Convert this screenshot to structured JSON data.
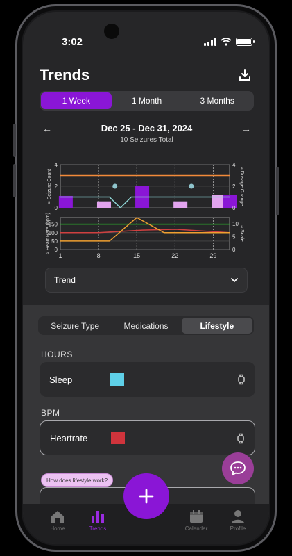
{
  "status": {
    "time": "3:02"
  },
  "header": {
    "title": "Trends"
  },
  "range_tabs": [
    {
      "label": "1 Week",
      "active": true
    },
    {
      "label": "1 Month",
      "active": false
    },
    {
      "label": "3 Months",
      "active": false
    }
  ],
  "date_nav": {
    "range": "Dec 25 - Dec 31, 2024",
    "subtitle": "10 Seizures Total"
  },
  "chart_data": [
    {
      "type": "bar",
      "y_axis_left": {
        "label": "Seizure Count",
        "ticks": [
          "0",
          "2",
          "4"
        ],
        "ylim": [
          0,
          4
        ]
      },
      "y_axis_right": {
        "label": "Dosage Change",
        "ticks": [
          "0",
          "2",
          "4"
        ],
        "ylim": [
          0,
          4
        ]
      },
      "bars": [
        {
          "x": 1,
          "value": 1.1,
          "color": "#8a16d6"
        },
        {
          "x": 8,
          "value": 0.6,
          "color": "#e2a4ef"
        },
        {
          "x": 15,
          "value": 2.0,
          "color": "#8a16d6"
        },
        {
          "x": 22,
          "value": 0.6,
          "color": "#e2a4ef"
        },
        {
          "x": 29,
          "value": 1.2,
          "color": "#e2a4ef"
        },
        {
          "x": 31,
          "value": 1.2,
          "color": "#8a16d6"
        }
      ],
      "markers": [
        {
          "x": 10,
          "value": 2.0
        },
        {
          "x": 24,
          "value": 2.0
        }
      ],
      "reference_lines": [
        {
          "value": 3.0,
          "color": "#f28a3a"
        }
      ],
      "series": [
        {
          "color": "#8fd6d6",
          "points": [
            [
              0,
              1.0
            ],
            [
              9,
              1.0
            ],
            [
              11,
              0.0
            ],
            [
              13,
              1.0
            ],
            [
              31,
              1.0
            ]
          ]
        }
      ]
    },
    {
      "type": "line",
      "x_ticks": [
        "1",
        "8",
        "15",
        "22",
        "29"
      ],
      "y_axis_left": {
        "label": "Heart Rate (bpm)",
        "ticks": [
          "0",
          "50",
          "100",
          "150"
        ],
        "ylim": [
          0,
          150
        ]
      },
      "y_axis_right": {
        "label": "Scale",
        "ticks": [
          "0",
          "5",
          "10"
        ],
        "ylim": [
          0,
          10
        ]
      },
      "series": [
        {
          "color": "#2fbf2f",
          "axis": "left",
          "points": [
            [
              0,
              150
            ],
            [
              31,
              150
            ]
          ]
        },
        {
          "color": "#d04040",
          "axis": "left",
          "points": [
            [
              0,
              100
            ],
            [
              7,
              100
            ],
            [
              15,
              115
            ],
            [
              21,
              120
            ],
            [
              31,
              100
            ]
          ]
        },
        {
          "color": "#f0a030",
          "axis": "left",
          "points": [
            [
              0,
              50
            ],
            [
              9,
              50
            ],
            [
              14,
              190
            ],
            [
              19,
              100
            ],
            [
              31,
              100
            ]
          ]
        }
      ]
    }
  ],
  "trend_select": {
    "value": "Trend"
  },
  "detail_tabs": [
    {
      "label": "Seizure Type",
      "active": false
    },
    {
      "label": "Medications",
      "active": false
    },
    {
      "label": "Lifestyle",
      "active": true
    }
  ],
  "sections": [
    {
      "heading": "HOURS",
      "metric": "Sleep",
      "color": "#5fd0e8"
    },
    {
      "heading": "BPM",
      "metric": "Heartrate",
      "color": "#d0343c"
    }
  ],
  "help_pill": "How does lifestyle work?",
  "tabbar": [
    {
      "label": "Home",
      "icon": "home-icon",
      "active": false
    },
    {
      "label": "Trends",
      "icon": "bar-chart-icon",
      "active": true
    },
    {
      "label": "Calendar",
      "icon": "calendar-icon",
      "active": false
    },
    {
      "label": "Profile",
      "icon": "person-icon",
      "active": false
    }
  ]
}
